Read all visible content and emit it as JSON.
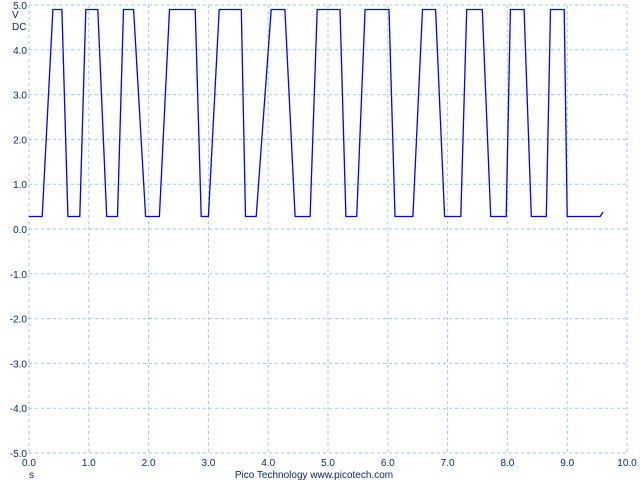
{
  "chart_data": {
    "type": "line",
    "title": "",
    "xlabel": "s",
    "ylabel": "V DC",
    "y_unit_lines": [
      "V",
      "DC"
    ],
    "xlim": [
      0.0,
      10.0
    ],
    "ylim": [
      -5.0,
      5.0
    ],
    "x_ticks": [
      "0.0",
      "1.0",
      "2.0",
      "3.0",
      "4.0",
      "5.0",
      "6.0",
      "7.0",
      "8.0",
      "9.0",
      "10.0"
    ],
    "y_ticks": [
      "5.0",
      "4.0",
      "3.0",
      "2.0",
      "1.0",
      "0.0",
      "-1.0",
      "-2.0",
      "-3.0",
      "-4.0",
      "-5.0"
    ],
    "grid": true,
    "colors": {
      "trace": "#0000ff",
      "grid": "#9ecae6",
      "text": "#0a2a66"
    },
    "series": [
      {
        "values_description": "",
        "x": [
          0.0,
          0.22,
          0.4,
          0.45,
          0.55,
          0.65,
          0.85,
          0.95,
          1.0,
          1.1,
          1.15,
          1.3,
          1.48,
          1.58,
          1.62,
          1.75,
          1.95,
          2.1,
          2.18,
          2.35,
          2.52,
          2.78,
          2.88,
          2.92,
          3.0,
          3.18,
          3.38,
          3.48,
          3.55,
          3.62,
          3.8,
          4.05,
          4.15,
          4.22,
          4.28,
          4.45,
          4.55,
          4.7,
          4.82,
          4.88,
          5.05,
          5.2,
          5.3,
          5.38,
          5.48,
          5.62,
          5.78,
          5.92,
          6.02,
          6.12,
          6.22,
          6.42,
          6.58,
          6.72,
          6.8,
          6.95,
          7.08,
          7.22,
          7.32,
          7.45,
          7.58,
          7.72,
          7.86,
          7.98,
          8.05,
          8.15,
          8.28,
          8.4,
          8.54,
          8.65,
          8.72,
          8.85,
          8.95,
          9.0,
          9.2,
          9.4,
          9.55,
          9.6
        ],
        "y": [
          0.28,
          0.28,
          4.9,
          4.9,
          4.9,
          0.28,
          0.28,
          4.9,
          4.9,
          4.9,
          4.9,
          0.28,
          0.28,
          4.9,
          4.9,
          4.9,
          0.28,
          0.28,
          0.28,
          4.9,
          4.9,
          4.9,
          0.28,
          0.28,
          0.28,
          4.9,
          4.9,
          4.9,
          4.9,
          0.28,
          0.28,
          4.9,
          4.9,
          4.9,
          4.9,
          0.28,
          0.28,
          0.28,
          4.9,
          4.9,
          4.9,
          4.9,
          0.28,
          0.28,
          0.28,
          4.9,
          4.9,
          4.9,
          4.9,
          0.28,
          0.28,
          0.28,
          4.9,
          4.9,
          4.9,
          0.28,
          0.28,
          0.28,
          4.9,
          4.9,
          4.9,
          0.28,
          0.28,
          0.28,
          4.9,
          4.9,
          4.9,
          0.28,
          0.28,
          0.28,
          4.9,
          4.9,
          4.9,
          0.28,
          0.28,
          0.28,
          0.28,
          0.38
        ]
      }
    ]
  },
  "footer": {
    "credit": "Pico Technology  www.picotech.com"
  }
}
